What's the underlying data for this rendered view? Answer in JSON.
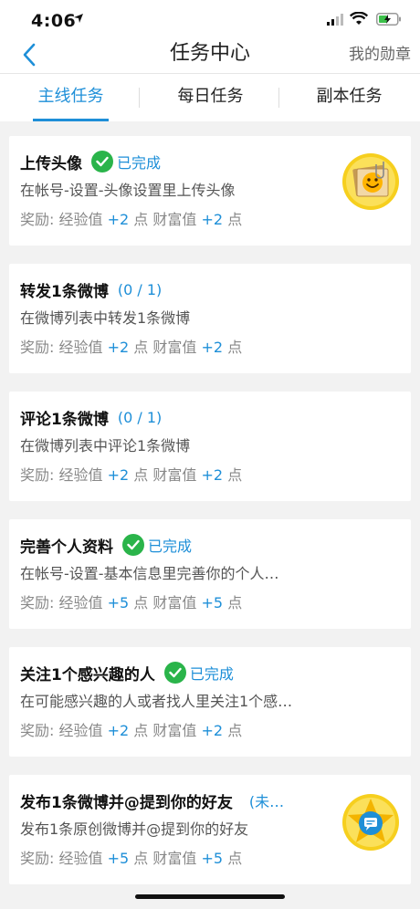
{
  "status": {
    "time": "4:06"
  },
  "nav": {
    "title": "任务中心",
    "right": "我的勋章"
  },
  "tabs": [
    "主线任务",
    "每日任务",
    "副本任务"
  ],
  "colors": {
    "accent": "#1e8fd8",
    "check": "#2ab44a"
  },
  "tasks": [
    {
      "title": "上传头像",
      "status": "已完成",
      "desc": "在帐号-设置-头像设置里上传头像",
      "reward": {
        "label": "奖励:",
        "exp_label": "经验值",
        "exp": "+2",
        "unit": "点",
        "wealth_label": "财富值",
        "wealth": "+2",
        "unit2": "点"
      },
      "badge": "smile-photo-badge"
    },
    {
      "title": "转发1条微博",
      "progress": "(0 / 1)",
      "desc": "在微博列表中转发1条微博",
      "reward": {
        "label": "奖励:",
        "exp_label": "经验值",
        "exp": "+2",
        "unit": "点",
        "wealth_label": "财富值",
        "wealth": "+2",
        "unit2": "点"
      }
    },
    {
      "title": "评论1条微博",
      "progress": "(0 / 1)",
      "desc": "在微博列表中评论1条微博",
      "reward": {
        "label": "奖励:",
        "exp_label": "经验值",
        "exp": "+2",
        "unit": "点",
        "wealth_label": "财富值",
        "wealth": "+2",
        "unit2": "点"
      }
    },
    {
      "title": "完善个人资料",
      "status": "已完成",
      "desc": "在帐号-设置-基本信息里完善你的个人…",
      "reward": {
        "label": "奖励:",
        "exp_label": "经验值",
        "exp": "+5",
        "unit": "点",
        "wealth_label": "财富值",
        "wealth": "+5",
        "unit2": "点"
      }
    },
    {
      "title": "关注1个感兴趣的人",
      "status": "已完成",
      "desc": "在可能感兴趣的人或者找人里关注1个感…",
      "reward": {
        "label": "奖励:",
        "exp_label": "经验值",
        "exp": "+2",
        "unit": "点",
        "wealth_label": "财富值",
        "wealth": "+2",
        "unit2": "点"
      }
    },
    {
      "title": "发布1条微博并@提到你的好友",
      "progress": "(未…",
      "desc": "发布1条原创微博并@提到你的好友",
      "reward": {
        "label": "奖励:",
        "exp_label": "经验值",
        "exp": "+5",
        "unit": "点",
        "wealth_label": "财富值",
        "wealth": "+5",
        "unit2": "点"
      },
      "badge": "chat-star-badge"
    }
  ]
}
